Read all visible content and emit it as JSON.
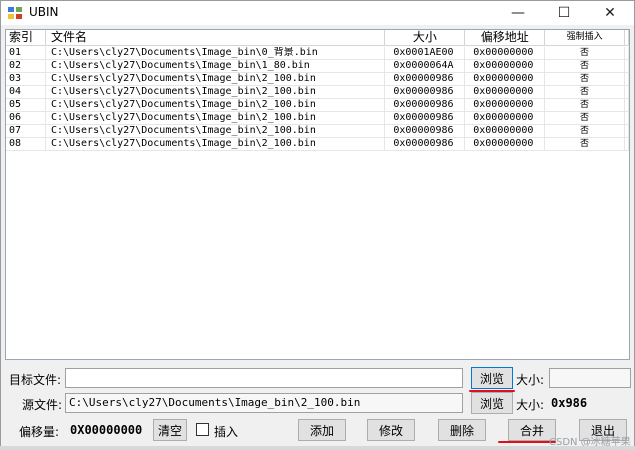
{
  "window": {
    "title": "UBIN",
    "minimize_glyph": "—",
    "maximize_glyph": "☐",
    "close_glyph": "✕",
    "icon": "app-ubin-icon"
  },
  "list": {
    "columns": [
      "索引",
      "文件名",
      "大小",
      "偏移地址",
      "强制插入"
    ],
    "rows": [
      {
        "idx": "01",
        "name": "C:\\Users\\cly27\\Documents\\Image_bin\\0_背景.bin",
        "size": "0x0001AE00",
        "offset": "0x00000000",
        "force": "否"
      },
      {
        "idx": "02",
        "name": "C:\\Users\\cly27\\Documents\\Image_bin\\1_80.bin",
        "size": "0x0000064A",
        "offset": "0x00000000",
        "force": "否"
      },
      {
        "idx": "03",
        "name": "C:\\Users\\cly27\\Documents\\Image_bin\\2_100.bin",
        "size": "0x00000986",
        "offset": "0x00000000",
        "force": "否"
      },
      {
        "idx": "04",
        "name": "C:\\Users\\cly27\\Documents\\Image_bin\\2_100.bin",
        "size": "0x00000986",
        "offset": "0x00000000",
        "force": "否"
      },
      {
        "idx": "05",
        "name": "C:\\Users\\cly27\\Documents\\Image_bin\\2_100.bin",
        "size": "0x00000986",
        "offset": "0x00000000",
        "force": "否"
      },
      {
        "idx": "06",
        "name": "C:\\Users\\cly27\\Documents\\Image_bin\\2_100.bin",
        "size": "0x00000986",
        "offset": "0x00000000",
        "force": "否"
      },
      {
        "idx": "07",
        "name": "C:\\Users\\cly27\\Documents\\Image_bin\\2_100.bin",
        "size": "0x00000986",
        "offset": "0x00000000",
        "force": "否"
      },
      {
        "idx": "08",
        "name": "C:\\Users\\cly27\\Documents\\Image_bin\\2_100.bin",
        "size": "0x00000986",
        "offset": "0x00000000",
        "force": "否"
      }
    ]
  },
  "target": {
    "label": "目标文件:",
    "value": "",
    "browse_label": "浏览",
    "size_label": "大小:",
    "size_value": ""
  },
  "source": {
    "label": "源文件:",
    "value": "C:\\Users\\cly27\\Documents\\Image_bin\\2_100.bin",
    "browse_label": "浏览",
    "size_label": "大小:",
    "size_value": "0x986"
  },
  "offset": {
    "label": "偏移量:",
    "value": "0X00000000",
    "clear_label": "清空",
    "insert_label": "插入",
    "insert_checked": false
  },
  "actions": {
    "add": "添加",
    "modify": "修改",
    "delete": "删除",
    "merge": "合并",
    "exit": "退出"
  },
  "watermark": "CSDN @冰糖苹果",
  "colors": {
    "annotation_red": "#e0101a",
    "focus_blue": "#0078d7"
  }
}
